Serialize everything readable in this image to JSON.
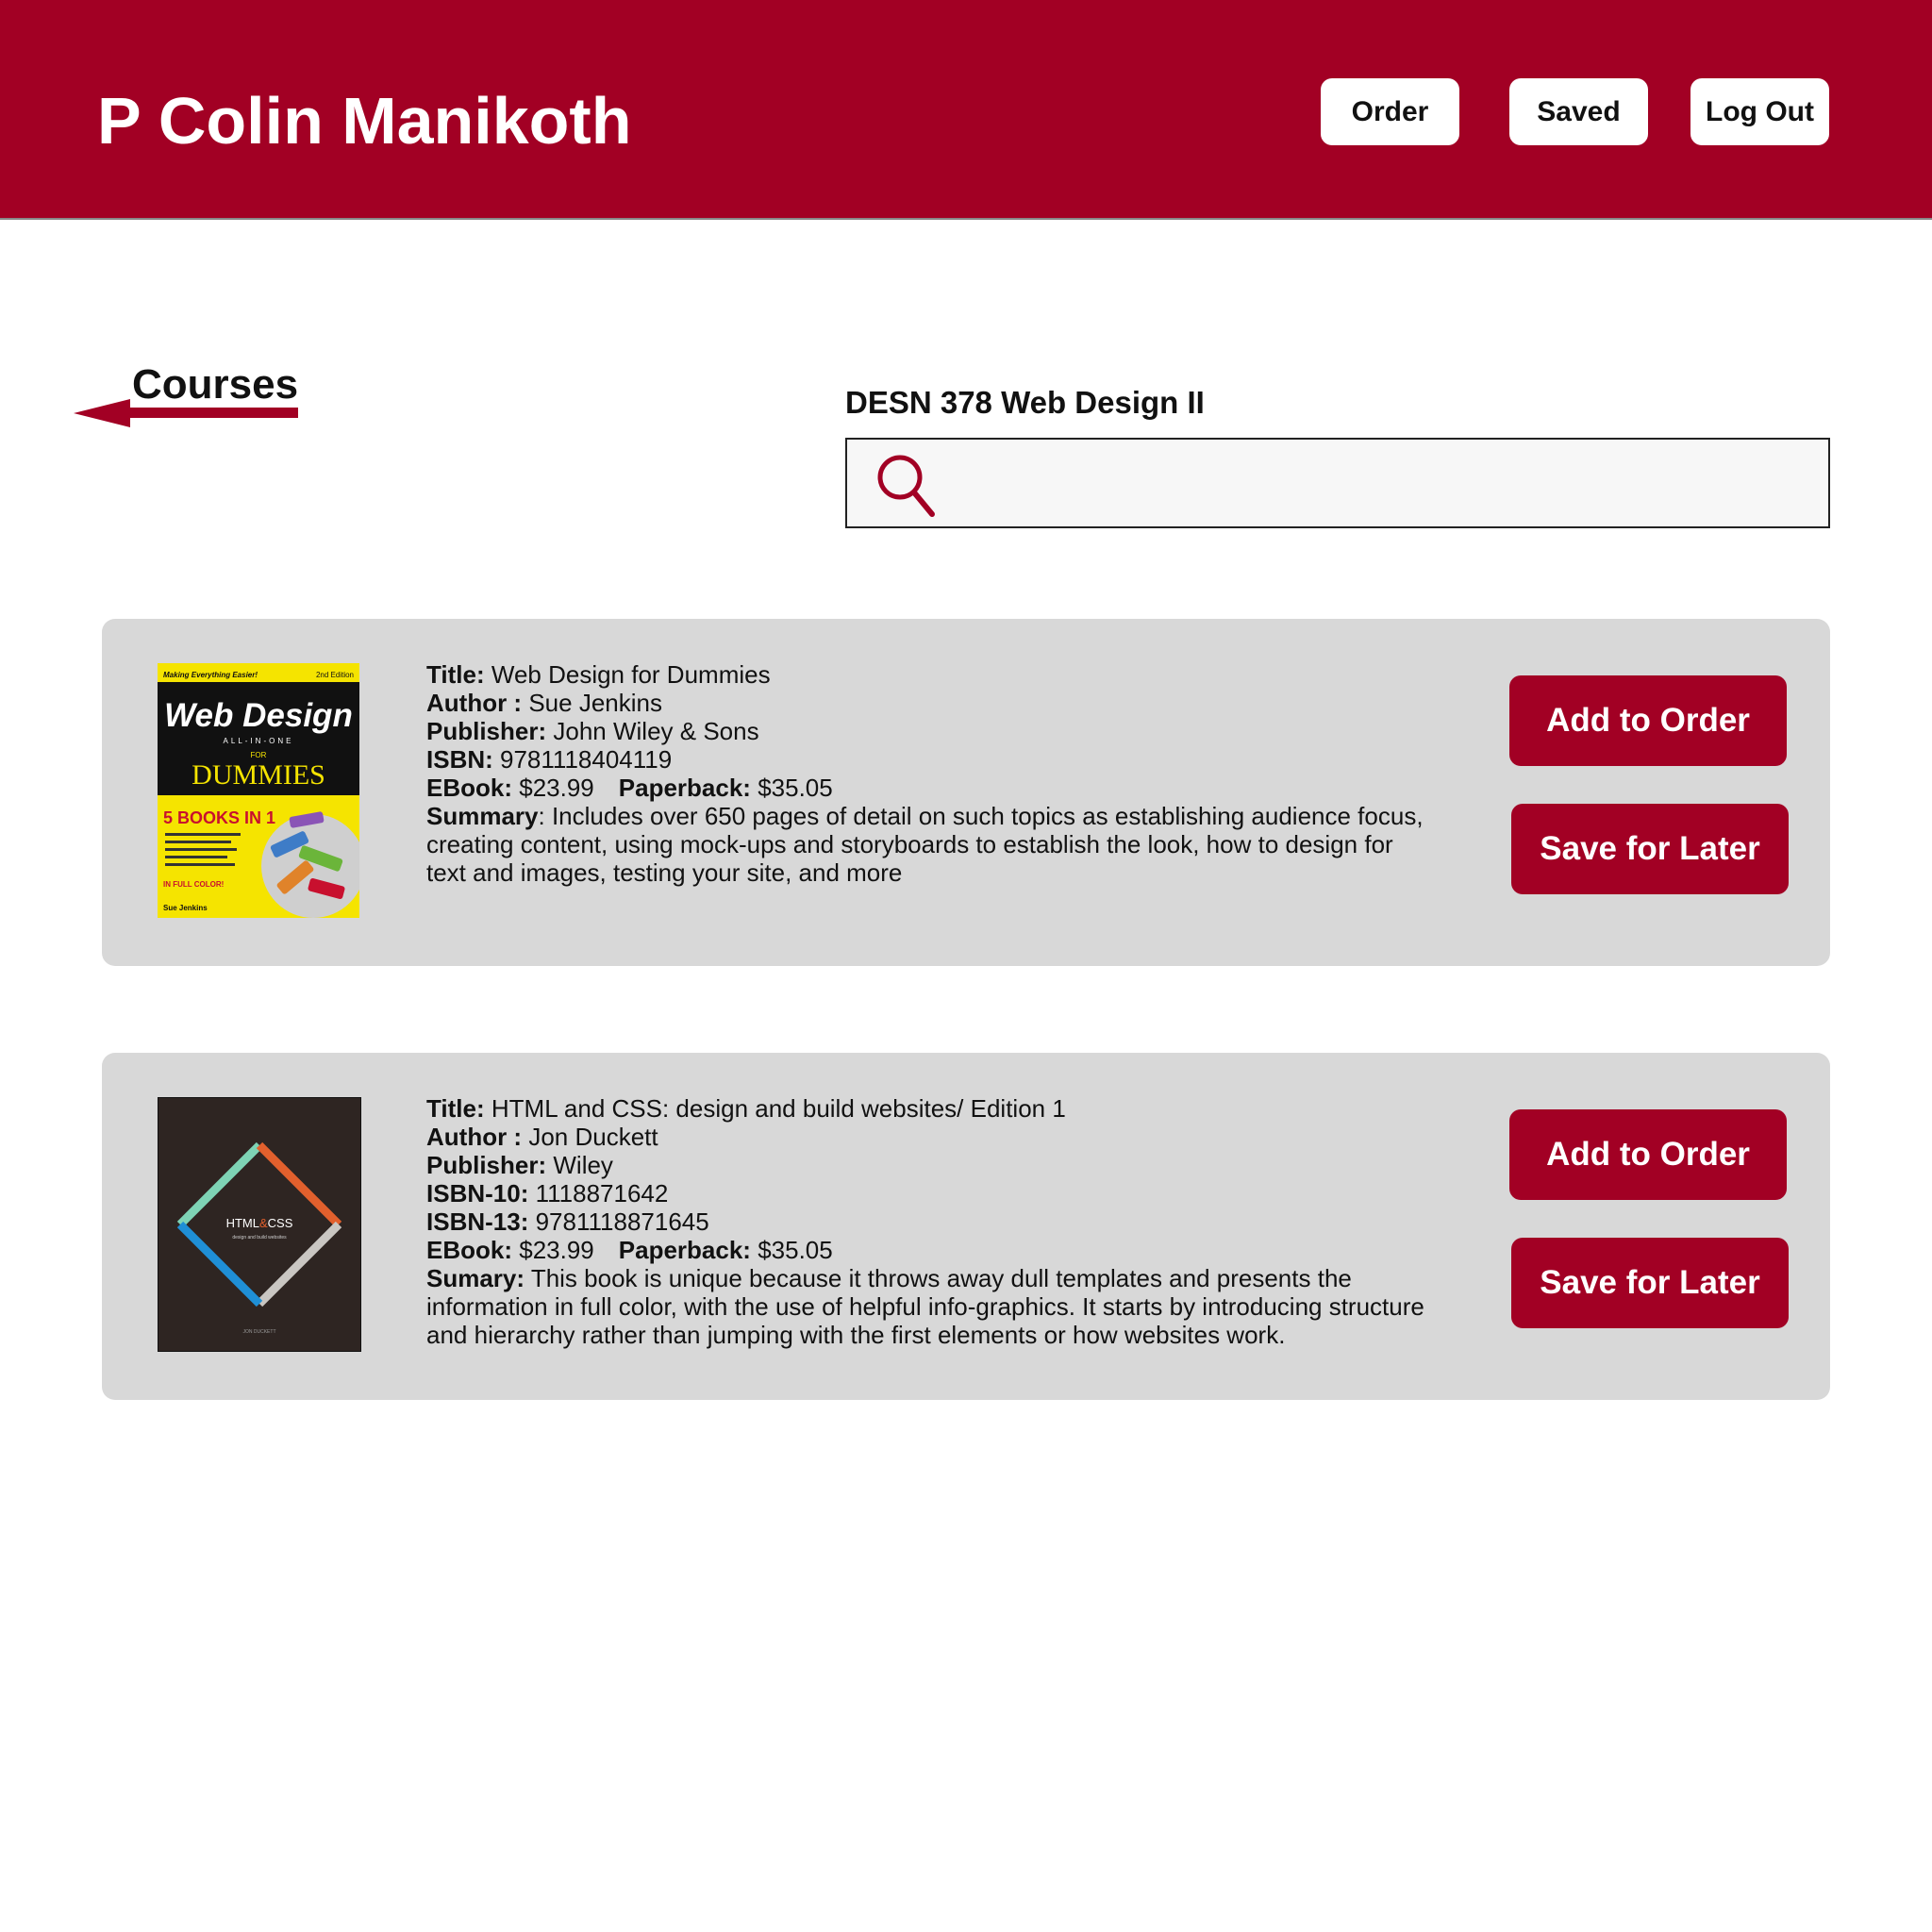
{
  "header": {
    "user_name": "P Colin Manikoth",
    "nav": {
      "order": "Order",
      "saved": "Saved",
      "logout": "Log Out"
    }
  },
  "back_link": {
    "label": "Courses",
    "icon": "arrow-left-icon"
  },
  "course": {
    "title": "DESN 378 Web Design II"
  },
  "search": {
    "placeholder": "",
    "value": "",
    "icon": "search-icon"
  },
  "colors": {
    "brand": "#a20024",
    "card": "#d8d8d8",
    "search_bg": "#f7f7f7"
  },
  "books": [
    {
      "title_label": "Title:",
      "title": "Web Design for Dummies",
      "author_label": "Author :",
      "author": "Sue Jenkins",
      "publisher_label": "Publisher:",
      "publisher": "John Wiley & Sons",
      "isbn_label": "ISBN:",
      "isbn": "9781118404119",
      "ebook_label": "EBook:",
      "ebook": "$23.99",
      "paperback_label": "Paperback:",
      "paperback": "$35.05",
      "summary_label": "Summary",
      "summary": ": Includes over 650 pages of detail on such topics as establishing audience focus, creating content, using mock-ups and storyboards to establish the look, how to design for text and images, testing your site, and more",
      "cover": {
        "tagline": "Making Everything Easier!",
        "edition": "2nd Edition",
        "heading": "Web Design",
        "subheading": "ALL-IN-ONE",
        "for_text": "FOR",
        "brand": "DUMMIES",
        "books_badge": "5 BOOKS IN 1",
        "full_color": "IN FULL COLOR!",
        "author": "Sue Jenkins"
      },
      "add_label": "Add to Order",
      "save_label": "Save for Later"
    },
    {
      "title_label": "Title:",
      "title": "HTML and CSS: design and build websites/ Edition 1",
      "author_label": "Author :",
      "author": "Jon Duckett",
      "publisher_label": "Publisher:",
      "publisher": "Wiley",
      "isbn10_label": "ISBN-10:",
      "isbn10": "1118871642",
      "isbn13_label": "ISBN-13:",
      "isbn13": "9781118871645",
      "ebook_label": "EBook:",
      "ebook": "$23.99",
      "paperback_label": "Paperback:",
      "paperback": "$35.05",
      "summary_label": "Sumary:",
      "summary": "This book is unique because it throws away dull templates and presents the information in full color, with the use of helpful info-graphics. It starts by introducing structure and hierarchy rather than jumping with the first elements or how websites work.",
      "cover": {
        "heading_html": "HTML",
        "heading_amp": "&",
        "heading_css": "CSS",
        "subtitle": "design and build websites",
        "author": "JON DUCKETT"
      },
      "add_label": "Add to Order",
      "save_label": "Save for Later"
    }
  ]
}
